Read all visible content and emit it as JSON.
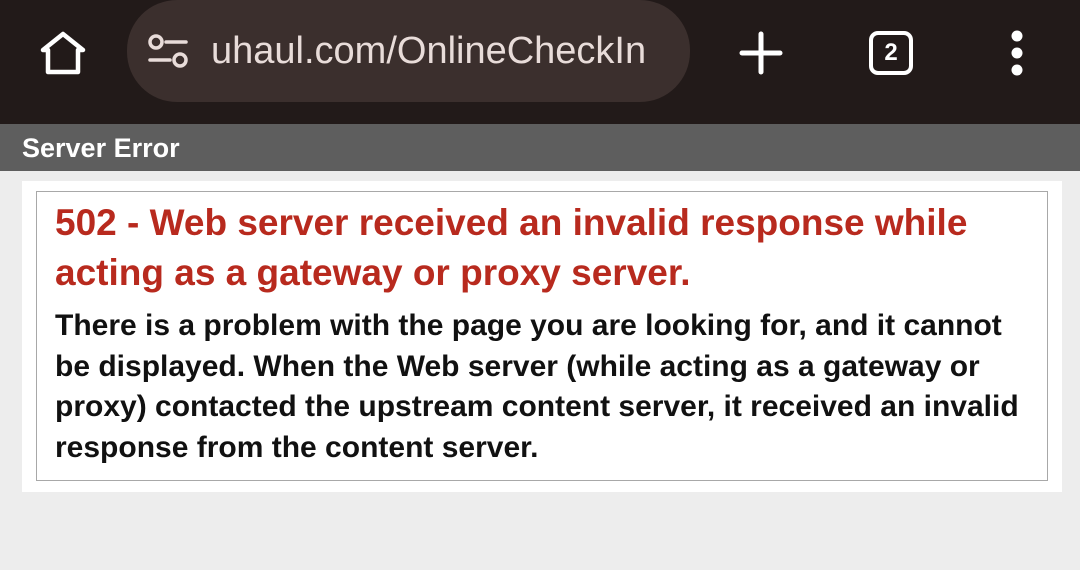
{
  "browser": {
    "url": "uhaul.com/OnlineCheckIn",
    "tab_count": "2",
    "icons": {
      "home": "home-icon",
      "site_settings": "site-settings-icon",
      "new_tab": "plus-icon",
      "tabs": "tab-switcher-icon",
      "menu": "more-vert-icon"
    },
    "colors": {
      "toolbar_bg": "#221a19",
      "address_bar_bg": "#3b2f2d"
    }
  },
  "page": {
    "header_title": "Server Error",
    "error_title": "502 - Web server received an invalid response while acting as a gateway or proxy server.",
    "error_description": "There is a problem with the page you are looking for, and it cannot be displayed. When the Web server (while acting as a gateway or proxy) contacted the upstream content server, it received an invalid response from the content server.",
    "colors": {
      "header_bg": "#5e5e5e",
      "error_title": "#b82a1e",
      "page_bg": "#ededed"
    }
  }
}
